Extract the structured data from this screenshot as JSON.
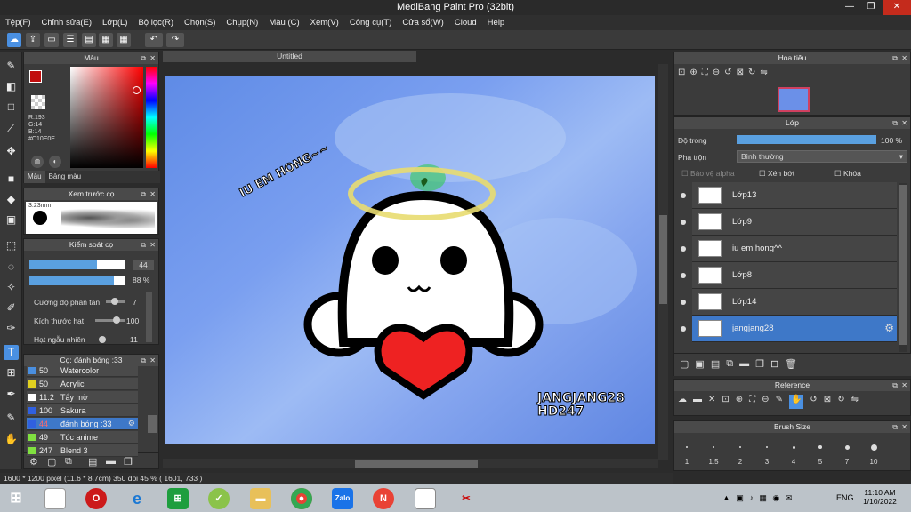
{
  "window": {
    "title": "MediBang Paint Pro (32bit)"
  },
  "menu": [
    "Tệp(F)",
    "Chỉnh sửa(E)",
    "Lớp(L)",
    "Bộ lọc(R)",
    "Chọn(S)",
    "Chụp(N)",
    "Màu (C)",
    "Xem(V)",
    "Công cụ(T)",
    "Cửa sổ(W)",
    "Cloud",
    "Help"
  ],
  "color_panel": {
    "title": "Màu",
    "r": "R:193",
    "g": "G:14",
    "b": "B:14",
    "hex": "#C10E0E",
    "tab1": "Màu",
    "tab2": "Bảng màu",
    "main_color": "#C10E0E"
  },
  "preview_panel": {
    "title": "Xem trước cọ",
    "size": "3.23mm"
  },
  "brush_control": {
    "title": "Kiểm soát cọ",
    "size_value": "44",
    "opacity_value": "88",
    "opacity_unit": "%",
    "scatter_label": "Cường độ phân tán",
    "scatter_value": "7",
    "grain_label": "Kích thước hạt",
    "grain_value": "100",
    "random_label": "Hạt ngẫu nhiên",
    "random_value": "11"
  },
  "brush_list": {
    "title": "Cọ: đánh bóng :33",
    "items": [
      {
        "size": "50",
        "name": "Watercolor",
        "color": "#4a8fe0"
      },
      {
        "size": "50",
        "name": "Acrylic",
        "color": "#e0d020"
      },
      {
        "size": "11.2",
        "name": "Tẩy mờ",
        "color": "#ffffff"
      },
      {
        "size": "100",
        "name": "Sakura",
        "color": "#3060e0"
      },
      {
        "size": "44",
        "name": "đánh bóng :33",
        "color": "#3060e0",
        "selected": true
      },
      {
        "size": "49",
        "name": "Tóc anime",
        "color": "#80e040"
      },
      {
        "size": "247",
        "name": "Blend 3",
        "color": "#80e040"
      }
    ]
  },
  "canvas": {
    "tab": "Untitled",
    "text1": "IU EM HONG~~",
    "text2": "JANGJANG28",
    "text3": "HD247"
  },
  "status": {
    "text": "1600 * 1200 pixel  (11.6 * 8.7cm)  350 dpi  45 %  ( 1601, 733 )"
  },
  "navigator": {
    "title": "Hoa tiêu"
  },
  "layer_panel": {
    "title": "Lớp",
    "opacity_label": "Độ trong",
    "opacity_value": "100 %",
    "opacity_fraction": 1.0,
    "blend_label": "Pha trộn",
    "blend_value": "Bình thường",
    "protect_alpha": "Bảo vệ alpha",
    "clip": "Xén bớt",
    "lock": "Khóa",
    "layers": [
      "Lớp13",
      "Lớp9",
      "iu em hong^^",
      "Lớp8",
      "Lớp14",
      "jangjang28"
    ]
  },
  "reference": {
    "title": "Reference"
  },
  "brush_size": {
    "title": "Brush Size",
    "sizes": [
      "1",
      "1.5",
      "2",
      "3",
      "4",
      "5",
      "7",
      "10"
    ]
  },
  "taskbar": {
    "time": "11:10 AM",
    "date": "1/10/2022",
    "lang": "ENG"
  }
}
